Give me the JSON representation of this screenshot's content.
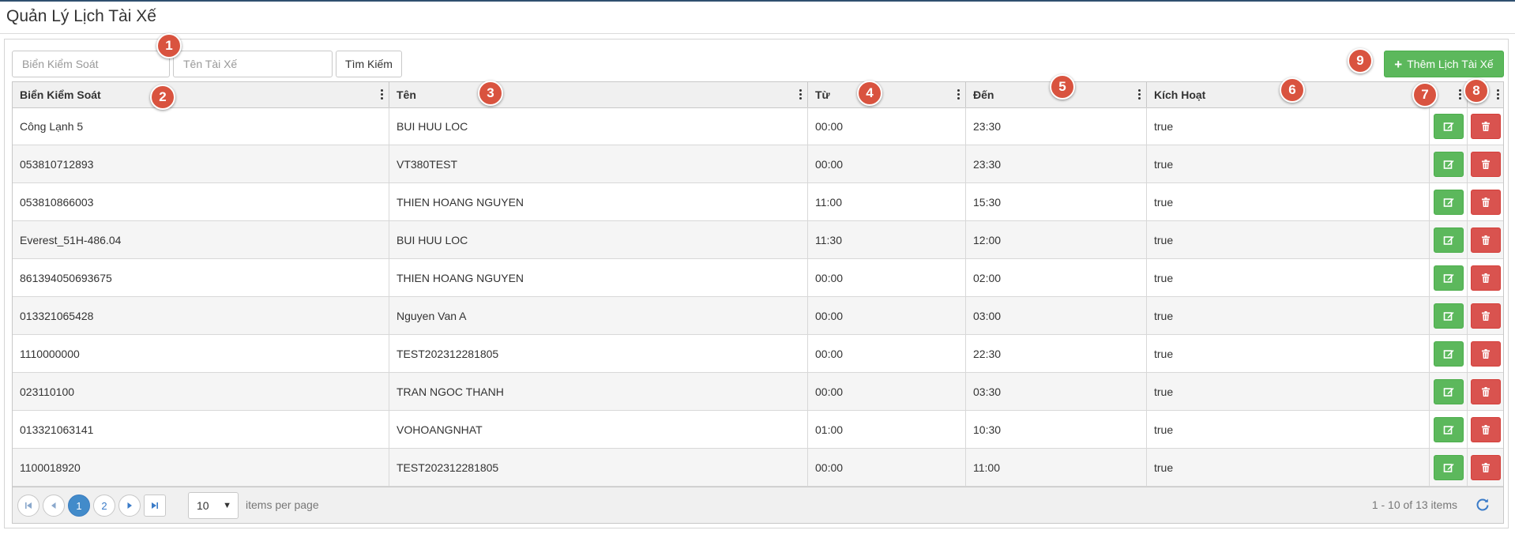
{
  "page": {
    "title": "Quản Lý Lịch Tài Xế"
  },
  "toolbar": {
    "plate_placeholder": "Biển Kiểm Soát",
    "name_placeholder": "Tên Tài Xế",
    "search_label": "Tìm Kiếm",
    "add_label": "Thêm Lịch Tài Xế"
  },
  "columns": {
    "plate": "Biển Kiểm Soát",
    "name": "Tên",
    "from": "Từ",
    "to": "Đến",
    "active": "Kích Hoạt"
  },
  "rows": [
    {
      "plate": "Công Lạnh 5",
      "name": "BUI HUU LOC",
      "from": "00:00",
      "to": "23:30",
      "active": "true"
    },
    {
      "plate": "053810712893",
      "name": "VT380TEST",
      "from": "00:00",
      "to": "23:30",
      "active": "true"
    },
    {
      "plate": "053810866003",
      "name": "THIEN HOANG NGUYEN",
      "from": "11:00",
      "to": "15:30",
      "active": "true"
    },
    {
      "plate": "Everest_51H-486.04",
      "name": "BUI HUU LOC",
      "from": "11:30",
      "to": "12:00",
      "active": "true"
    },
    {
      "plate": "861394050693675",
      "name": "THIEN HOANG NGUYEN",
      "from": "00:00",
      "to": "02:00",
      "active": "true"
    },
    {
      "plate": "013321065428",
      "name": "Nguyen Van A",
      "from": "00:00",
      "to": "03:00",
      "active": "true"
    },
    {
      "plate": "1110000000",
      "name": "TEST202312281805",
      "from": "00:00",
      "to": "22:30",
      "active": "true"
    },
    {
      "plate": "023110100",
      "name": "TRAN NGOC THANH",
      "from": "00:00",
      "to": "03:30",
      "active": "true"
    },
    {
      "plate": "013321063141",
      "name": "VOHOANGNHAT",
      "from": "01:00",
      "to": "10:30",
      "active": "true"
    },
    {
      "plate": "1100018920",
      "name": "TEST202312281805",
      "from": "00:00",
      "to": "11:00",
      "active": "true"
    }
  ],
  "pager": {
    "pages": [
      "1",
      "2"
    ],
    "current_page": "1",
    "page_size": "10",
    "items_per_page_label": "items per page",
    "range_text": "1 - 10 of 13 items"
  },
  "markers": [
    "1",
    "2",
    "3",
    "4",
    "5",
    "6",
    "7",
    "8",
    "9"
  ],
  "colors": {
    "edit_button": "#5cb85c",
    "delete_button": "#d9534f",
    "active_page": "#428bca",
    "marker": "#d9533f",
    "header_bg": "#f0f0f0"
  }
}
